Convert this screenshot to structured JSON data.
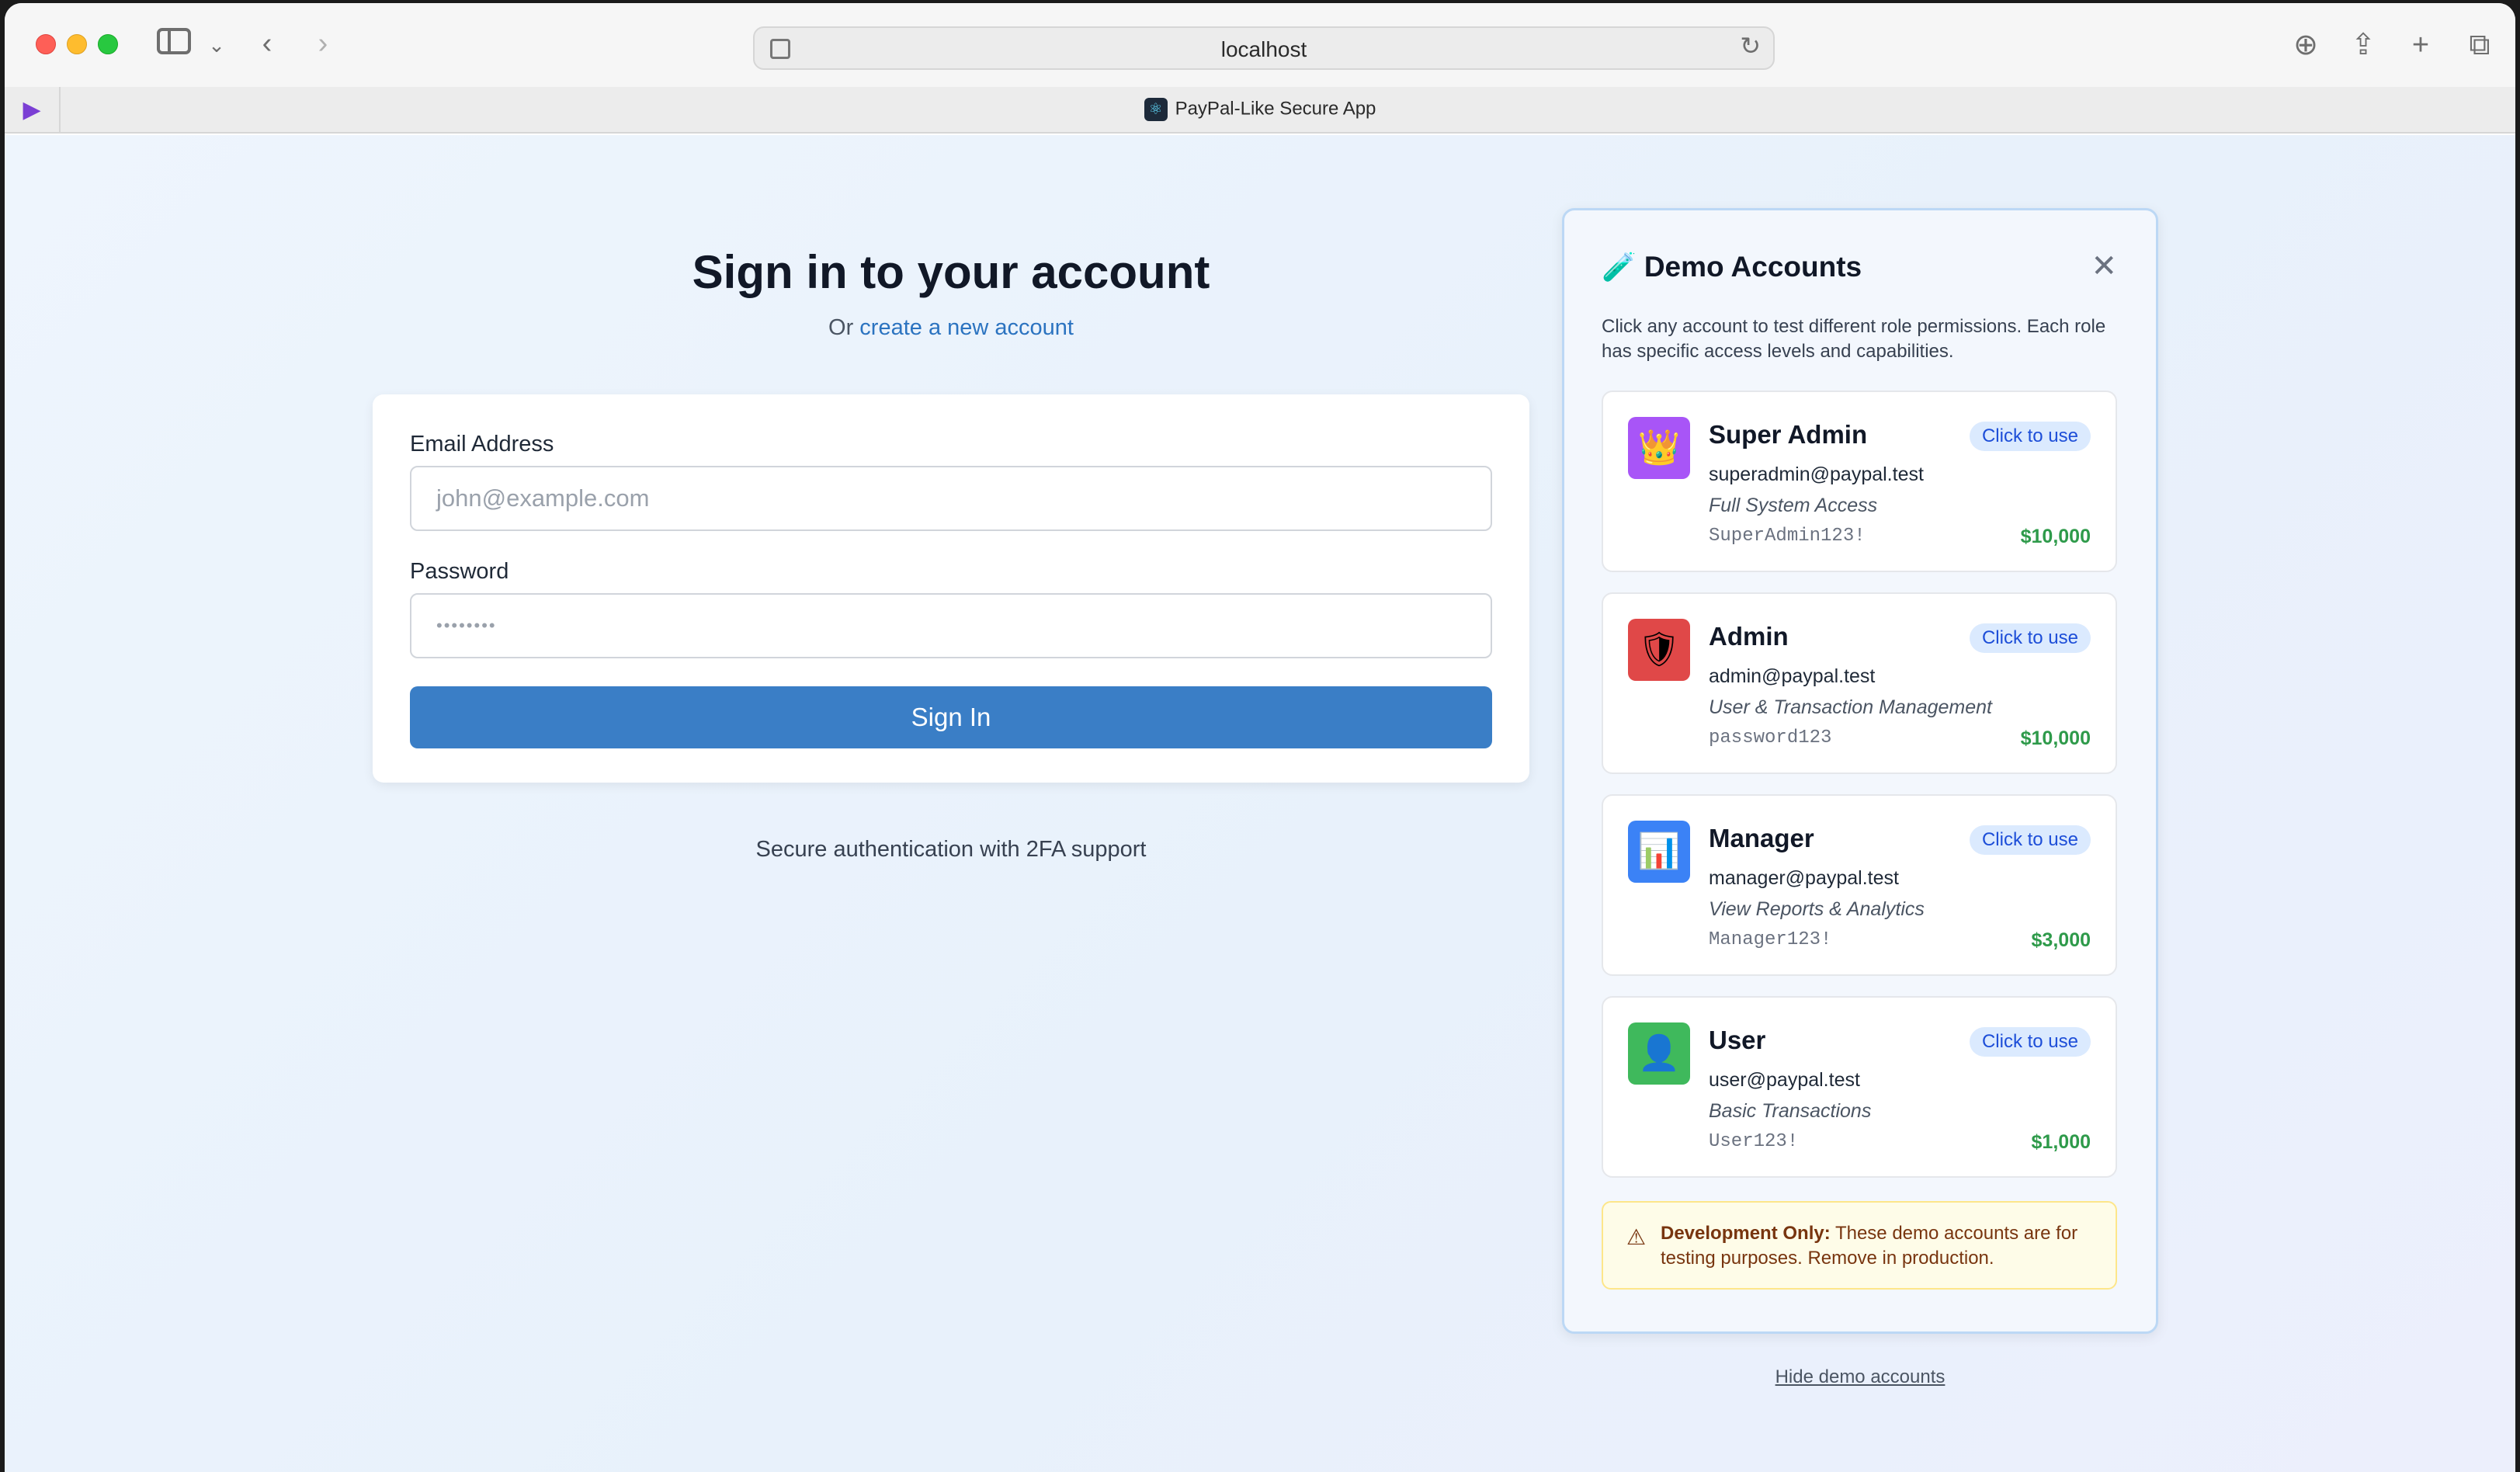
{
  "browser": {
    "url": "localhost",
    "tab_title": "PayPal-Like Secure App"
  },
  "login": {
    "title": "Sign in to your account",
    "subtitle_prefix": "Or",
    "create_link": "create a new account",
    "email_label": "Email Address",
    "email_placeholder": "john@example.com",
    "password_label": "Password",
    "password_placeholder": "••••••••",
    "signin_label": "Sign In",
    "secure_note": "Secure authentication with 2FA support"
  },
  "demo": {
    "title": "Demo Accounts",
    "close_symbol": "✕",
    "description": "Click any account to test different role permissions. Each role has specific access levels and capabilities.",
    "accounts": [
      {
        "name": "Super Admin",
        "badge": "Click to use",
        "email": "superadmin@paypal.test",
        "role": "Full System Access",
        "password": "SuperAdmin123!",
        "balance": "$10,000",
        "icon": "crown-icon",
        "icon_color": "#a855f7",
        "glyph": "👑"
      },
      {
        "name": "Admin",
        "badge": "Click to use",
        "email": "admin@paypal.test",
        "role": "User & Transaction Management",
        "password": "password123",
        "balance": "$10,000",
        "icon": "shield-icon",
        "icon_color": "#e04848",
        "glyph": "🛡"
      },
      {
        "name": "Manager",
        "badge": "Click to use",
        "email": "manager@paypal.test",
        "role": "View Reports & Analytics",
        "password": "Manager123!",
        "balance": "$3,000",
        "icon": "chart-icon",
        "icon_color": "#3b82f6",
        "glyph": "📊"
      },
      {
        "name": "User",
        "badge": "Click to use",
        "email": "user@paypal.test",
        "role": "Basic Transactions",
        "password": "User123!",
        "balance": "$1,000",
        "icon": "user-icon",
        "icon_color": "#3fb95c",
        "glyph": "👤"
      }
    ],
    "dev_note_label": "Development Only:",
    "dev_note_text": "These demo accounts are for testing purposes. Remove in production.",
    "hide_link": "Hide demo accounts"
  }
}
